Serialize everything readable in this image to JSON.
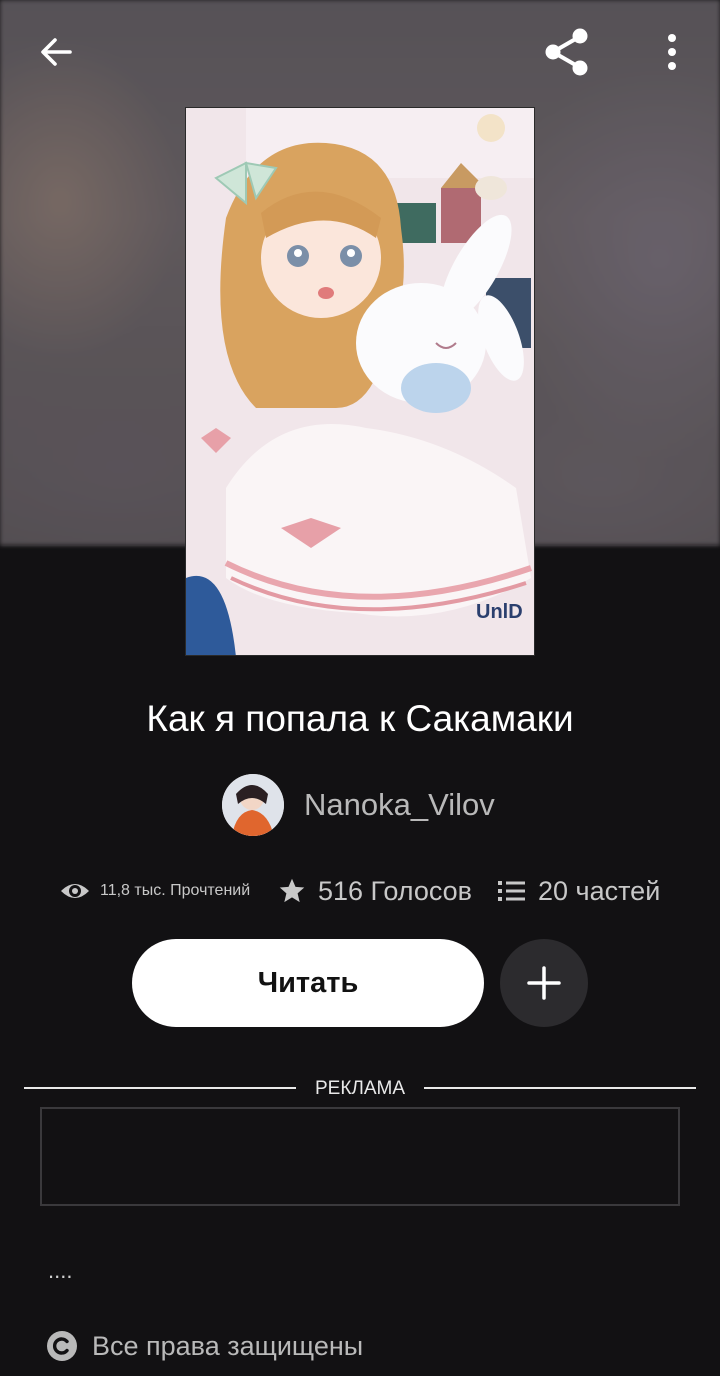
{
  "story": {
    "title": "Как я попала к Сакамаки",
    "author": "Nanoka_Vilov"
  },
  "stats": {
    "reads": "11,8 тыс. Прочтений",
    "votes": "516 Голосов",
    "parts": "20 частей"
  },
  "actions": {
    "read_label": "Читать",
    "add_icon": "plus-icon"
  },
  "ad": {
    "label": "РЕКЛАМА"
  },
  "description": "....",
  "rights": "Все права защищены",
  "icons": {
    "back": "arrow-left-icon",
    "share": "share-icon",
    "more": "more-vertical-icon",
    "eye": "eye-icon",
    "star": "star-icon",
    "list": "list-icon",
    "copyright": "copyright-icon"
  },
  "colors": {
    "background": "#121113",
    "button_bg": "#ffffff",
    "add_button_bg": "#2c2b2e",
    "muted_text": "#b9b9b9"
  }
}
